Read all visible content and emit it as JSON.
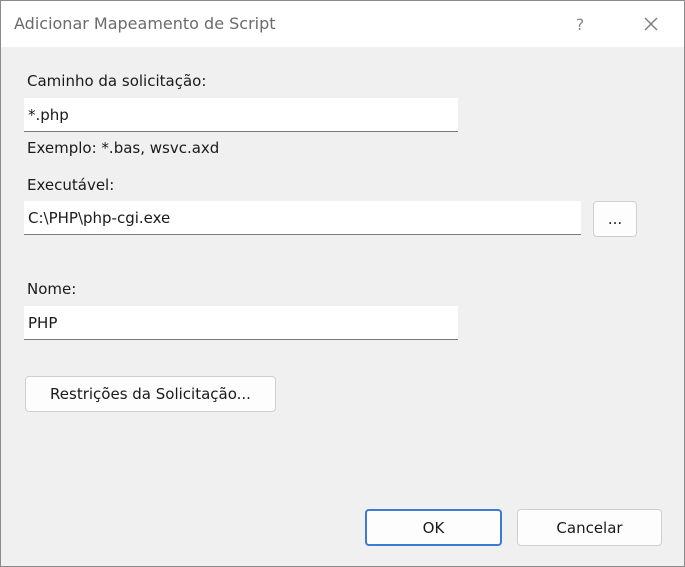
{
  "dialog": {
    "title": "Adicionar Mapeamento de Script",
    "help_label": "?",
    "close_icon": "close-icon"
  },
  "request_path": {
    "label": "Caminho da solicitação:",
    "value": "*.php",
    "example": "Exemplo: *.bas, wsvc.axd"
  },
  "executable": {
    "label": "Executável:",
    "value": "C:\\PHP\\php-cgi.exe",
    "browse_label": "..."
  },
  "name": {
    "label": "Nome:",
    "value": "PHP"
  },
  "restrictions_button": "Restrições da Solicitação...",
  "footer": {
    "ok_label": "OK",
    "cancel_label": "Cancelar"
  },
  "colors": {
    "title_bar": "#ffffff",
    "dialog_body": "#f0f0f0",
    "primary_border": "#3b7bd4"
  }
}
